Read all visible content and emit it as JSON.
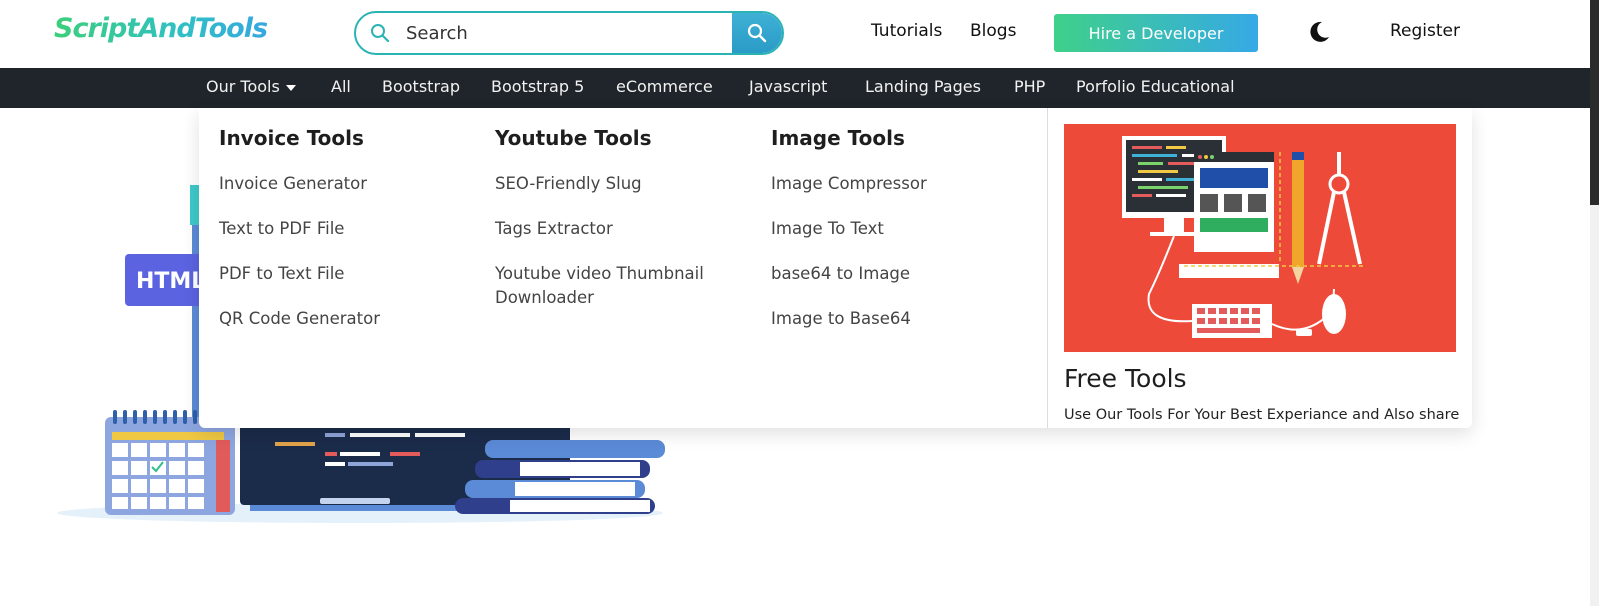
{
  "header": {
    "logo_text": "ScriptAndTools",
    "search_placeholder": "Search",
    "links": [
      "Tutorials",
      "Blogs"
    ],
    "hire_button": "Hire a Developer",
    "register": "Register"
  },
  "navbar": {
    "items": [
      "Our Tools",
      "All",
      "Bootstrap",
      "Bootstrap 5",
      "eCommerce",
      "Javascript",
      "Landing Pages",
      "PHP",
      "Porfolio Educational"
    ]
  },
  "illustration": {
    "badge_text": "HTML"
  },
  "mega_menu": {
    "columns": [
      {
        "title": "Invoice Tools",
        "links": [
          "Invoice Generator",
          "Text to PDF File",
          "PDF to Text File",
          "QR Code Generator"
        ]
      },
      {
        "title": "Youtube Tools",
        "links": [
          "SEO-Friendly Slug",
          "Tags Extractor",
          "Youtube video Thumbnail Downloader"
        ]
      },
      {
        "title": "Image Tools",
        "links": [
          "Image Compressor",
          "Image To Text",
          "base64 to Image",
          "Image to Base64"
        ]
      }
    ],
    "promo": {
      "title": "Free Tools",
      "description": "Use Our Tools For Your Best Experiance and Also share"
    }
  },
  "colors": {
    "accent_teal": "#2ab3b3",
    "navbar_bg": "#20252b",
    "promo_bg": "#ee4a3a"
  }
}
